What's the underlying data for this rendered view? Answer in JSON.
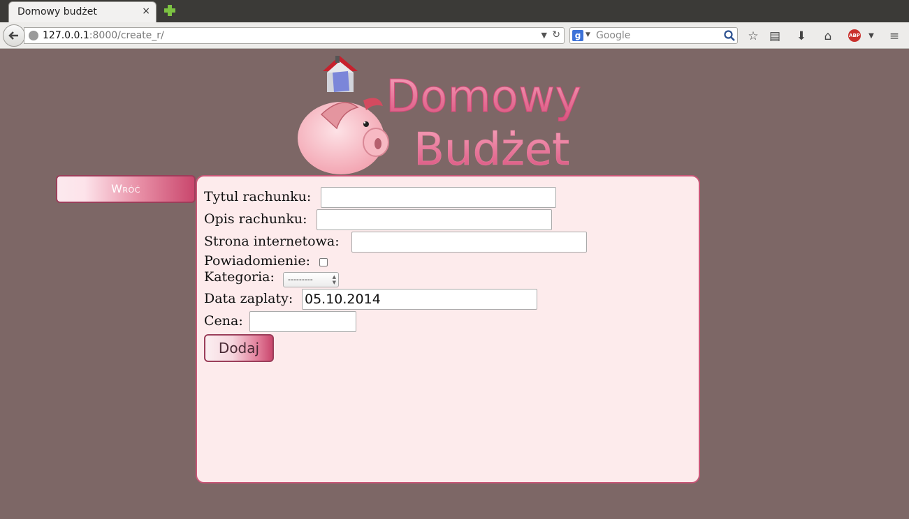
{
  "browser": {
    "tab_title": "Domowy budżet",
    "tab_close": "×",
    "url_host": "127.0.0.1",
    "url_path": ":8000/create_r/",
    "search_placeholder": "Google"
  },
  "logo": {
    "line1": "Domowy",
    "line2": "Budżet"
  },
  "nav": {
    "back_label": "Wróć"
  },
  "form": {
    "title_label": "Tytul rachunku:",
    "title_value": "",
    "description_label": "Opis rachunku:",
    "description_value": "",
    "website_label": "Strona internetowa:",
    "website_value": "",
    "notification_label": "Powiadomienie:",
    "notification_checked": false,
    "category_label": "Kategoria:",
    "category_selected": "---------",
    "date_label": "Data zaplaty:",
    "date_value": "05.10.2014",
    "price_label": "Cena:",
    "price_value": "",
    "submit_label": "Dodaj"
  },
  "colors": {
    "page_bg": "#7d6766",
    "panel_bg": "#fdebec",
    "panel_border": "#c95778",
    "accent": "#c9476d"
  }
}
